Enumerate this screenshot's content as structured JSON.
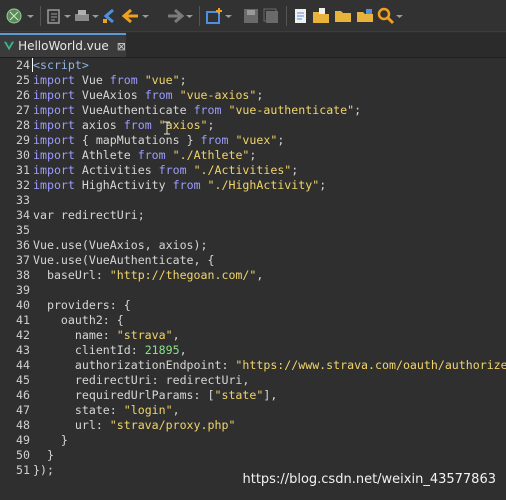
{
  "tab": {
    "title": "HelloWorld.vue",
    "close": "⊠"
  },
  "toolbar": {
    "items": [
      "globe-run-icon",
      "new-wizard-icon",
      "print-icon",
      "back-nav-icon",
      "back-arrow-icon",
      "forward-arrow-icon",
      "new-item-icon",
      "save-icon",
      "save-all-icon",
      "doc-icon",
      "open-folder-icon",
      "folder-icon",
      "folder-open-icon",
      "search-icon"
    ]
  },
  "colors": {
    "keyword": "#9c9cff",
    "string": "#f0d46a",
    "number": "#8be28b",
    "text": "#d6d6d6",
    "tag": "#8fb4e0"
  },
  "code_lines": [
    {
      "n": "24",
      "tokens": [
        {
          "t": "tag",
          "v": "<script>"
        }
      ]
    },
    {
      "n": "25",
      "tokens": [
        {
          "t": "kw",
          "v": "import"
        },
        {
          "t": "txt",
          "v": " Vue "
        },
        {
          "t": "kw",
          "v": "from"
        },
        {
          "t": "txt",
          "v": " "
        },
        {
          "t": "str",
          "v": "\"vue\""
        },
        {
          "t": "txt",
          "v": ";"
        }
      ]
    },
    {
      "n": "26",
      "tokens": [
        {
          "t": "kw",
          "v": "import"
        },
        {
          "t": "txt",
          "v": " VueAxios "
        },
        {
          "t": "kw",
          "v": "from"
        },
        {
          "t": "txt",
          "v": " "
        },
        {
          "t": "str",
          "v": "\"vue-axios\""
        },
        {
          "t": "txt",
          "v": ";"
        }
      ]
    },
    {
      "n": "27",
      "tokens": [
        {
          "t": "kw",
          "v": "import"
        },
        {
          "t": "txt",
          "v": " VueAuthenticate "
        },
        {
          "t": "kw",
          "v": "from"
        },
        {
          "t": "txt",
          "v": " "
        },
        {
          "t": "str",
          "v": "\"vue-authenticate\""
        },
        {
          "t": "txt",
          "v": ";"
        }
      ]
    },
    {
      "n": "28",
      "tokens": [
        {
          "t": "kw",
          "v": "import"
        },
        {
          "t": "txt",
          "v": " axios "
        },
        {
          "t": "kw",
          "v": "from"
        },
        {
          "t": "txt",
          "v": " "
        },
        {
          "t": "str",
          "v": "\"axios\""
        },
        {
          "t": "txt",
          "v": ";"
        }
      ]
    },
    {
      "n": "29",
      "tokens": [
        {
          "t": "kw",
          "v": "import"
        },
        {
          "t": "txt",
          "v": " { mapMutations } "
        },
        {
          "t": "kw",
          "v": "from"
        },
        {
          "t": "txt",
          "v": " "
        },
        {
          "t": "str",
          "v": "\"vuex\""
        },
        {
          "t": "txt",
          "v": ";"
        }
      ]
    },
    {
      "n": "30",
      "tokens": [
        {
          "t": "kw",
          "v": "import"
        },
        {
          "t": "txt",
          "v": " Athlete "
        },
        {
          "t": "kw",
          "v": "from"
        },
        {
          "t": "txt",
          "v": " "
        },
        {
          "t": "str",
          "v": "\"./Athlete\""
        },
        {
          "t": "txt",
          "v": ";"
        }
      ]
    },
    {
      "n": "31",
      "tokens": [
        {
          "t": "kw",
          "v": "import"
        },
        {
          "t": "txt",
          "v": " Activities "
        },
        {
          "t": "kw",
          "v": "from"
        },
        {
          "t": "txt",
          "v": " "
        },
        {
          "t": "str",
          "v": "\"./Activities\""
        },
        {
          "t": "txt",
          "v": ";"
        }
      ]
    },
    {
      "n": "32",
      "tokens": [
        {
          "t": "kw",
          "v": "import"
        },
        {
          "t": "txt",
          "v": " HighActivity "
        },
        {
          "t": "kw",
          "v": "from"
        },
        {
          "t": "txt",
          "v": " "
        },
        {
          "t": "str",
          "v": "\"./HighActivity\""
        },
        {
          "t": "txt",
          "v": ";"
        }
      ]
    },
    {
      "n": "33",
      "tokens": []
    },
    {
      "n": "34",
      "tokens": [
        {
          "t": "txt",
          "v": "var redirectUri;"
        }
      ]
    },
    {
      "n": "35",
      "tokens": []
    },
    {
      "n": "36",
      "tokens": [
        {
          "t": "txt",
          "v": "Vue.use(VueAxios, axios);"
        }
      ]
    },
    {
      "n": "37",
      "tokens": [
        {
          "t": "txt",
          "v": "Vue.use(VueAuthenticate, {"
        }
      ]
    },
    {
      "n": "38",
      "tokens": [
        {
          "t": "txt",
          "v": "  baseUrl: "
        },
        {
          "t": "str",
          "v": "\"http://thegoan.com/\""
        },
        {
          "t": "txt",
          "v": ","
        }
      ]
    },
    {
      "n": "39",
      "tokens": []
    },
    {
      "n": "40",
      "tokens": [
        {
          "t": "txt",
          "v": "  providers: {"
        }
      ]
    },
    {
      "n": "41",
      "tokens": [
        {
          "t": "txt",
          "v": "    oauth2: {"
        }
      ]
    },
    {
      "n": "42",
      "tokens": [
        {
          "t": "txt",
          "v": "      name: "
        },
        {
          "t": "str",
          "v": "\"strava\""
        },
        {
          "t": "txt",
          "v": ","
        }
      ]
    },
    {
      "n": "43",
      "tokens": [
        {
          "t": "txt",
          "v": "      clientId: "
        },
        {
          "t": "num",
          "v": "21895"
        },
        {
          "t": "txt",
          "v": ","
        }
      ]
    },
    {
      "n": "44",
      "tokens": [
        {
          "t": "txt",
          "v": "      authorizationEndpoint: "
        },
        {
          "t": "str",
          "v": "\"https://www.strava.com/oauth/authorize"
        }
      ]
    },
    {
      "n": "45",
      "tokens": [
        {
          "t": "txt",
          "v": "      redirectUri: redirectUri,"
        }
      ]
    },
    {
      "n": "46",
      "tokens": [
        {
          "t": "txt",
          "v": "      requiredUrlParams: ["
        },
        {
          "t": "str",
          "v": "\"state\""
        },
        {
          "t": "txt",
          "v": "],"
        }
      ]
    },
    {
      "n": "47",
      "tokens": [
        {
          "t": "txt",
          "v": "      state: "
        },
        {
          "t": "str",
          "v": "\"login\""
        },
        {
          "t": "txt",
          "v": ","
        }
      ]
    },
    {
      "n": "48",
      "tokens": [
        {
          "t": "txt",
          "v": "      url: "
        },
        {
          "t": "str",
          "v": "\"strava/proxy.php\""
        }
      ]
    },
    {
      "n": "49",
      "tokens": [
        {
          "t": "txt",
          "v": "    }"
        }
      ]
    },
    {
      "n": "50",
      "tokens": [
        {
          "t": "txt",
          "v": "  }"
        }
      ]
    },
    {
      "n": "51",
      "tokens": [
        {
          "t": "txt",
          "v": "});"
        }
      ]
    }
  ],
  "watermark": "https://blog.csdn.net/weixin_43577863"
}
